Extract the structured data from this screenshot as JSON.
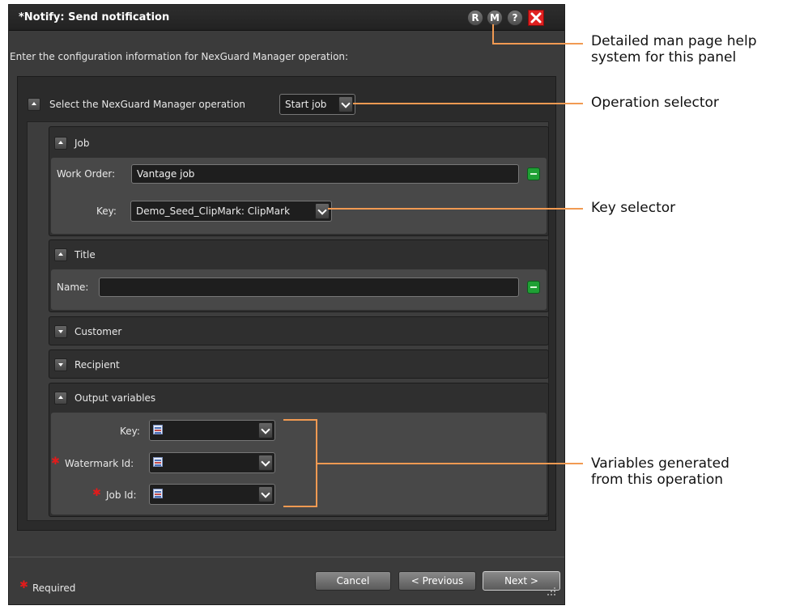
{
  "dialog": {
    "title": "*Notify: Send notification",
    "titlebar_buttons": {
      "r": "R",
      "m": "M",
      "help": "?"
    },
    "close_icon": "close-icon",
    "intro": "Enter the configuration information for NexGuard Manager operation:"
  },
  "operation": {
    "label": "Select the NexGuard Manager operation",
    "value": "Start job"
  },
  "job": {
    "title": "Job",
    "work_order_label": "Work Order:",
    "work_order_value": "Vantage job",
    "key_label": "Key:",
    "key_value": "Demo_Seed_ClipMark: ClipMark"
  },
  "title_section": {
    "title": "Title",
    "name_label": "Name:",
    "name_value": ""
  },
  "customer": {
    "title": "Customer"
  },
  "recipient": {
    "title": "Recipient"
  },
  "output": {
    "title": "Output variables",
    "key_label": "Key:",
    "watermark_label": "Watermark Id:",
    "job_id_label": "Job Id:"
  },
  "footer": {
    "required": "Required",
    "cancel": "Cancel",
    "previous": "< Previous",
    "next": "Next >"
  },
  "callouts": {
    "help": [
      "Detailed man page help",
      "system for this panel"
    ],
    "operation": "Operation selector",
    "key": "Key selector",
    "variables": [
      "Variables generated",
      "from this operation"
    ]
  },
  "colors": {
    "callout_line": "#f19a52",
    "required_star": "#e11b1b",
    "add_button": "#1fa035",
    "close_button": "#e02020"
  }
}
